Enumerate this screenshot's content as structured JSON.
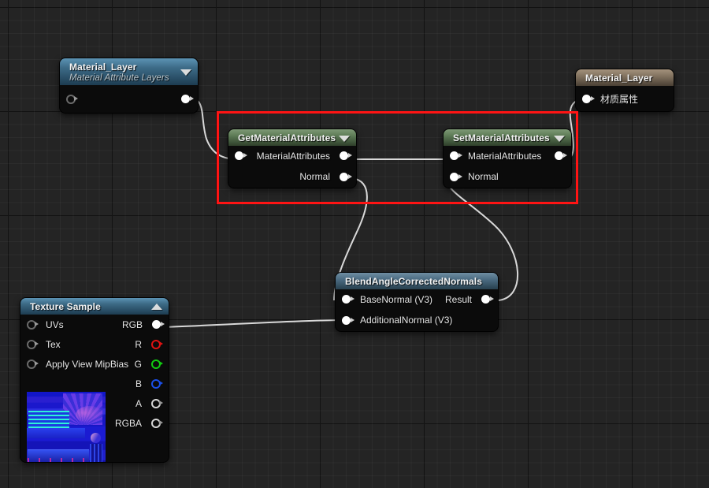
{
  "app": {
    "context": "unreal-material-graph",
    "canvas_background": "#242424",
    "annotation_color": "#ff1414"
  },
  "nodes": {
    "material_layer_left": {
      "title": "Material_Layer",
      "subtitle": "Material Attribute Layers",
      "header_color": "#3d6b87",
      "inputs": [
        {
          "label": "",
          "pin": "hollow"
        }
      ],
      "outputs": [
        {
          "label": "",
          "pin": "filled"
        }
      ],
      "caret": "chevron-down"
    },
    "get_material_attributes": {
      "title": "GetMaterialAttributes",
      "header_color": "#5c7a55",
      "inputs": [
        {
          "label": "",
          "pin": "filled"
        }
      ],
      "outputs": [
        {
          "label": "MaterialAttributes",
          "pin": "filled"
        },
        {
          "label": "Normal",
          "pin": "filled"
        }
      ],
      "caret": "chevron-down"
    },
    "set_material_attributes": {
      "title": "SetMaterialAttributes",
      "header_color": "#5c7a55",
      "inputs": [
        {
          "label": "MaterialAttributes",
          "pin": "filled"
        },
        {
          "label": "Normal",
          "pin": "filled"
        }
      ],
      "outputs": [
        {
          "label": "",
          "pin": "filled"
        }
      ],
      "caret": "chevron-down"
    },
    "material_layer_right": {
      "title": "Material_Layer",
      "header_color": "#7e6f5c",
      "inputs": [
        {
          "label": "材质属性",
          "pin": "filled"
        }
      ]
    },
    "blend_angle_corrected_normals": {
      "title": "BlendAngleCorrectedNormals",
      "header_color": "#4c6c82",
      "inputs": [
        {
          "label": "BaseNormal (V3)",
          "pin": "filled"
        },
        {
          "label": "AdditionalNormal (V3)",
          "pin": "filled"
        }
      ],
      "outputs": [
        {
          "label": "Result",
          "pin": "filled"
        }
      ]
    },
    "texture_sample": {
      "title": "Texture Sample",
      "header_color": "#3d6b87",
      "caret": "chevron-up",
      "inputs": [
        {
          "label": "UVs",
          "pin": "hollow"
        },
        {
          "label": "Tex",
          "pin": "hollow"
        },
        {
          "label": "Apply View MipBias",
          "pin": "hollow"
        }
      ],
      "outputs": [
        {
          "label": "RGB",
          "pin": "filled",
          "color": "#ffffff"
        },
        {
          "label": "R",
          "pin": "red-h",
          "color": "#e01212"
        },
        {
          "label": "G",
          "pin": "green-h",
          "color": "#11cc11"
        },
        {
          "label": "B",
          "pin": "blue-h",
          "color": "#1b4fe8"
        },
        {
          "label": "A",
          "pin": "white-h",
          "color": "#d8d8d8"
        },
        {
          "label": "RGBA",
          "pin": "white-h",
          "color": "#d8d8d8"
        }
      ],
      "thumbnail": "texture-preview-normal-map"
    }
  },
  "connections": [
    {
      "from": "material_layer_left.out",
      "to": "get_material_attributes.in"
    },
    {
      "from": "get_material_attributes.MaterialAttributes",
      "to": "set_material_attributes.MaterialAttributes"
    },
    {
      "from": "get_material_attributes.Normal",
      "to": "blend_angle_corrected_normals.BaseNormal"
    },
    {
      "from": "texture_sample.RGB",
      "to": "blend_angle_corrected_normals.AdditionalNormal"
    },
    {
      "from": "blend_angle_corrected_normals.Result",
      "to": "set_material_attributes.Normal"
    },
    {
      "from": "set_material_attributes.out",
      "to": "material_layer_right.材质属性"
    }
  ]
}
